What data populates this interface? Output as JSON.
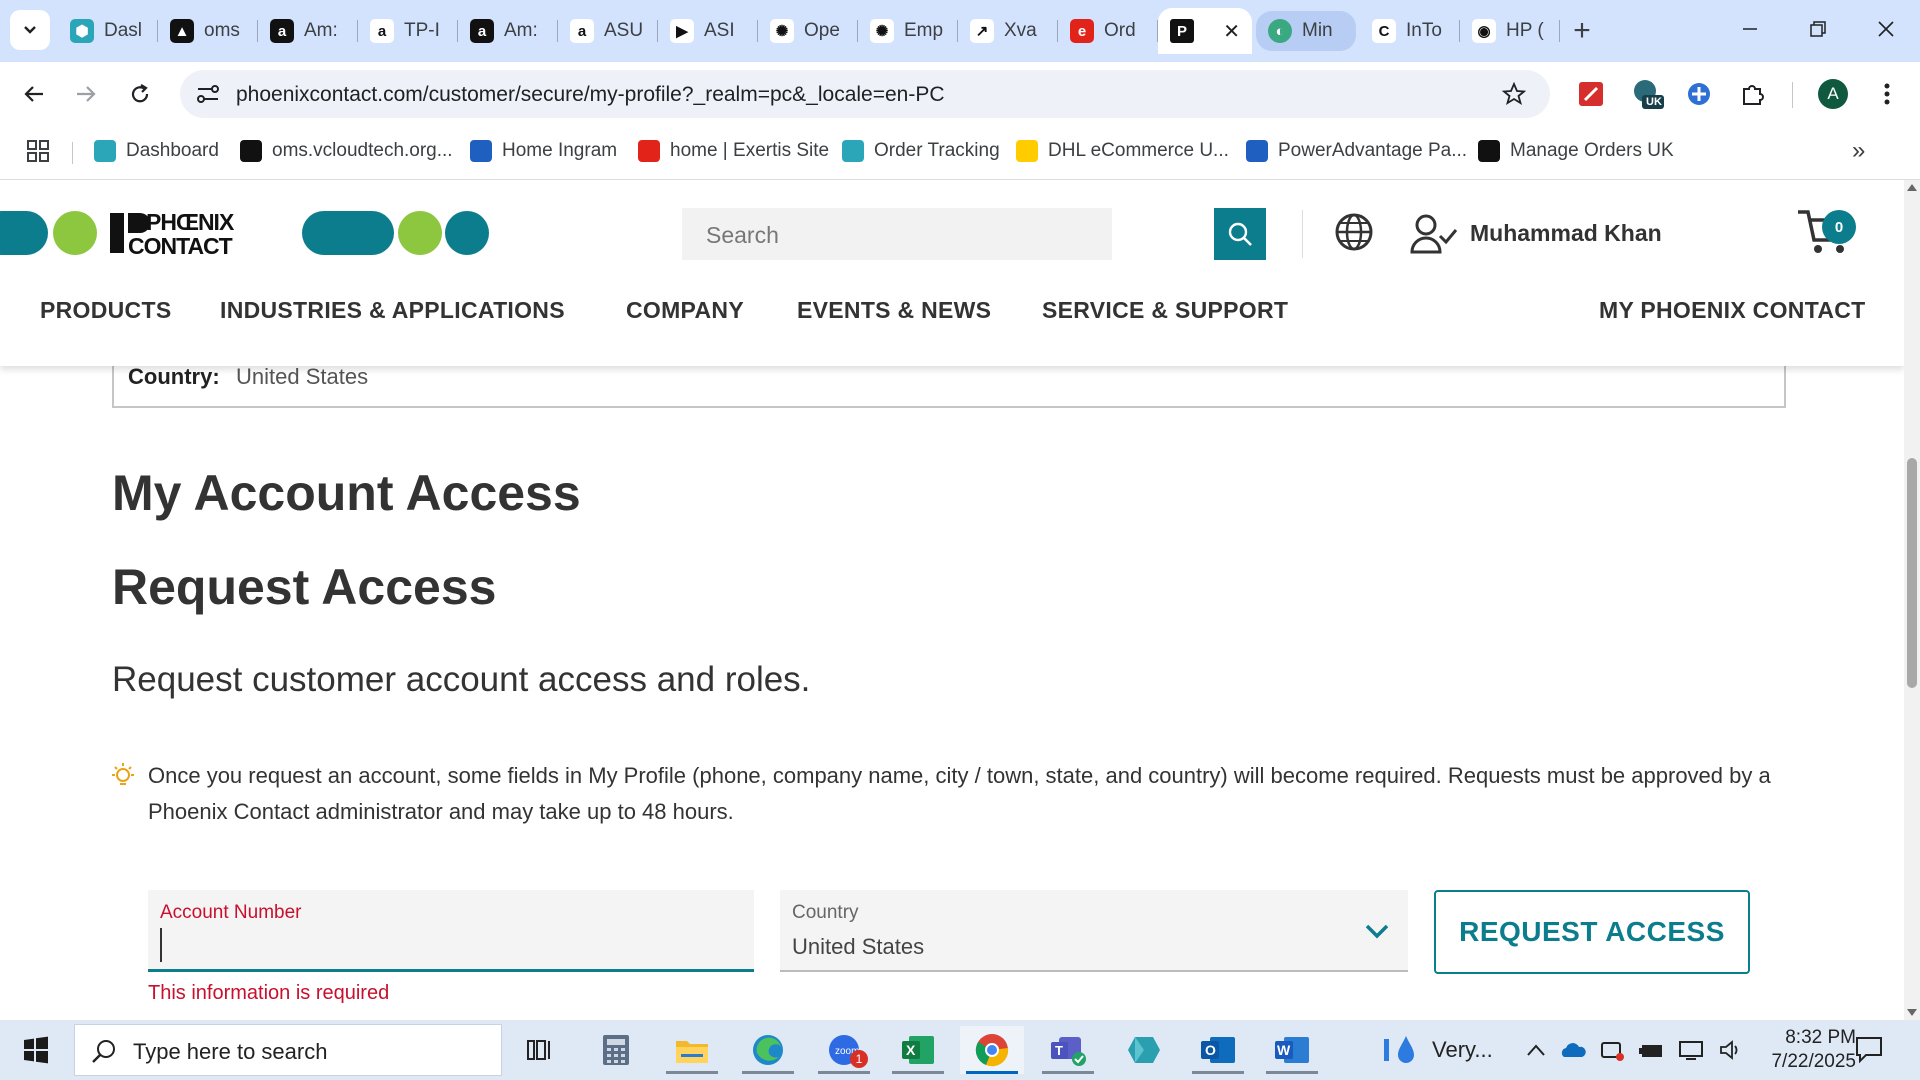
{
  "browser": {
    "tabs": [
      {
        "title": "Dasl",
        "fav_color": "#2aa6b8",
        "fav_glyph": "⬢"
      },
      {
        "title": "oms",
        "fav_color": "#111111",
        "fav_glyph": "▲"
      },
      {
        "title": "Am:",
        "fav_color": "#111111",
        "fav_glyph": "a"
      },
      {
        "title": "TP-I",
        "fav_color": "#ffffff",
        "fav_glyph": "a"
      },
      {
        "title": "Am:",
        "fav_color": "#111111",
        "fav_glyph": "a"
      },
      {
        "title": "ASU",
        "fav_color": "#ffffff",
        "fav_glyph": "a"
      },
      {
        "title": "ASI",
        "fav_color": "#ffffff",
        "fav_glyph": "▶"
      },
      {
        "title": "Ope",
        "fav_color": "#ffffff",
        "fav_glyph": "✺"
      },
      {
        "title": "Emp",
        "fav_color": "#ffffff",
        "fav_glyph": "✺"
      },
      {
        "title": "Xva",
        "fav_color": "#ffffff",
        "fav_glyph": "↗"
      },
      {
        "title": "Ord",
        "fav_color": "#e2231a",
        "fav_glyph": "e"
      }
    ],
    "active_tab": {
      "title": "",
      "close": "✕"
    },
    "highlight_tab": {
      "title": "Min"
    },
    "tabs_after": [
      {
        "title": "InTo",
        "fav_color": "#ffffff",
        "fav_glyph": "C"
      },
      {
        "title": "HP (",
        "fav_color": "#ffffff",
        "fav_glyph": "◉"
      }
    ],
    "new_tab": "+",
    "url": "phoenixcontact.com/customer/secure/my-profile?_realm=pc&_locale=en-PC",
    "profile_initial": "A",
    "ext_badge": "UK"
  },
  "bookmarks": [
    {
      "label": "Dashboard",
      "color": "#2aa6b8"
    },
    {
      "label": "oms.vcloudtech.org...",
      "color": "#111111"
    },
    {
      "label": "Home Ingram",
      "color": "#1f5fbf"
    },
    {
      "label": "home | Exertis Site",
      "color": "#e2231a"
    },
    {
      "label": "Order Tracking",
      "color": "#2aa6b8"
    },
    {
      "label": "DHL eCommerce U...",
      "color": "#ffcc00"
    },
    {
      "label": "PowerAdvantage Pa...",
      "color": "#1f5fbf"
    },
    {
      "label": "Manage Orders UK",
      "color": "#111111"
    }
  ],
  "site": {
    "search_placeholder": "Search",
    "user_name": "Muhammad Khan",
    "cart_count": "0",
    "nav": [
      "PRODUCTS",
      "INDUSTRIES & APPLICATIONS",
      "COMPANY",
      "EVENTS & NEWS",
      "SERVICE & SUPPORT",
      "MY PHOENIX CONTACT"
    ],
    "brand_color": "#0b7d8c",
    "accent_green": "#8dc63f"
  },
  "profile": {
    "country_label": "Country:",
    "country_value": "United States"
  },
  "access": {
    "heading": "My Account Access",
    "request_heading": "Request Access",
    "subtitle": "Request customer account access and roles.",
    "note": "Once you request an account, some fields in My Profile (phone, company name, city / town, state, and country) will become required. Requests must be approved by a Phoenix Contact administrator and may take up to 48 hours.",
    "account_label": "Account Number",
    "account_value": "",
    "account_error": "This information is required",
    "country_label": "Country",
    "country_value": "United States",
    "button": "REQUEST ACCESS",
    "error_color": "#c8102e"
  },
  "taskbar": {
    "search_placeholder": "Type here to search",
    "weather": "Very...",
    "time": "8:32 PM",
    "date": "7/22/2025",
    "zoom_badge": "1"
  }
}
